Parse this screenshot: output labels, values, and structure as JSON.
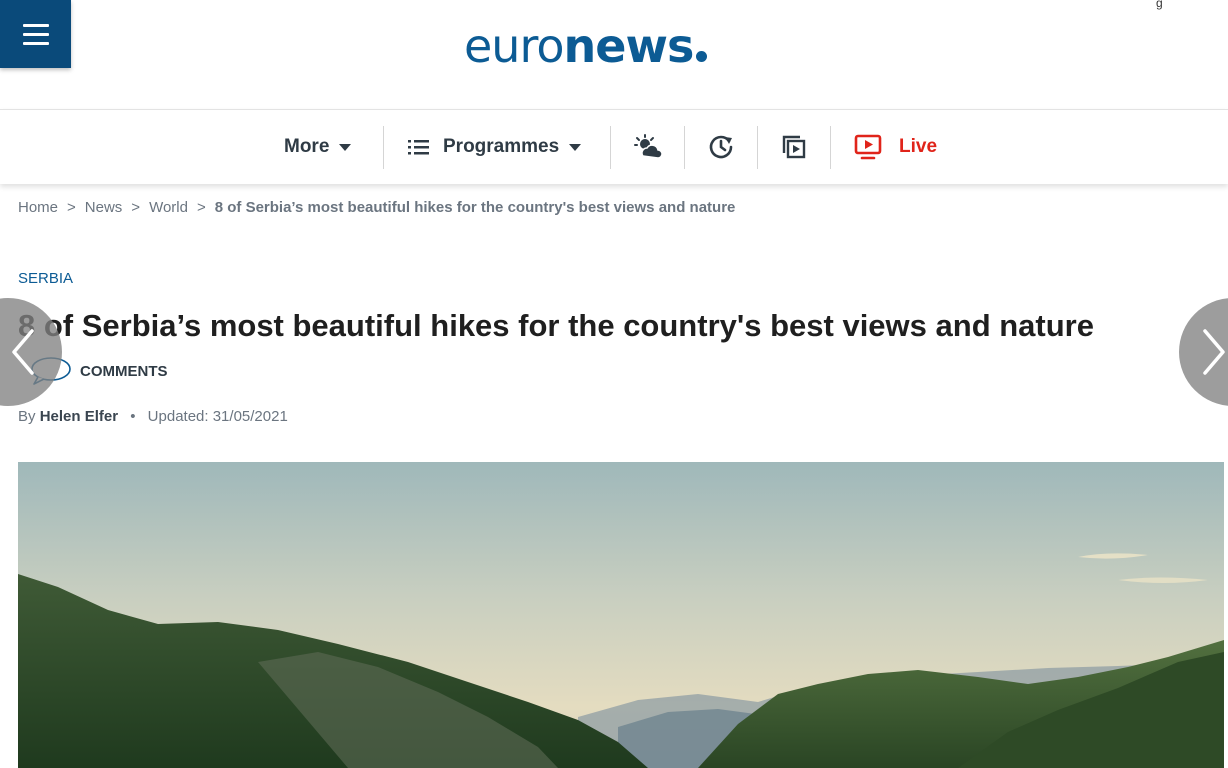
{
  "header": {
    "logo_light": "euro",
    "logo_bold": "news",
    "top_right_glyph": "g"
  },
  "nav": {
    "items": [
      {
        "label": "More",
        "icon": "caret-down-icon"
      },
      {
        "label": "Programmes",
        "icon": "list-icon"
      },
      {
        "label": "",
        "icon": "weather-icon"
      },
      {
        "label": "",
        "icon": "history-clock-icon"
      },
      {
        "label": "",
        "icon": "video-playlist-icon"
      },
      {
        "label": "Live",
        "icon": "tv-live-icon"
      }
    ],
    "live_color": "#e0241a"
  },
  "breadcrumb": {
    "items": [
      "Home",
      "News",
      "World"
    ],
    "current": "8 of Serbia’s most beautiful hikes for the country's best views and nature",
    "separator": ">"
  },
  "article": {
    "tag": "SERBIA",
    "title": "8 of Serbia’s most beautiful hikes for the country's best views and nature",
    "comments_label": "COMMENTS",
    "by_label": "By",
    "author": "Helen Elfer",
    "updated_label": "Updated: 31/05/2021",
    "dot": "•"
  },
  "colors": {
    "brand": "#0c5b94",
    "menu_bg": "#0a4a7a",
    "nav_text": "#2f3b45",
    "live": "#e0241a"
  }
}
